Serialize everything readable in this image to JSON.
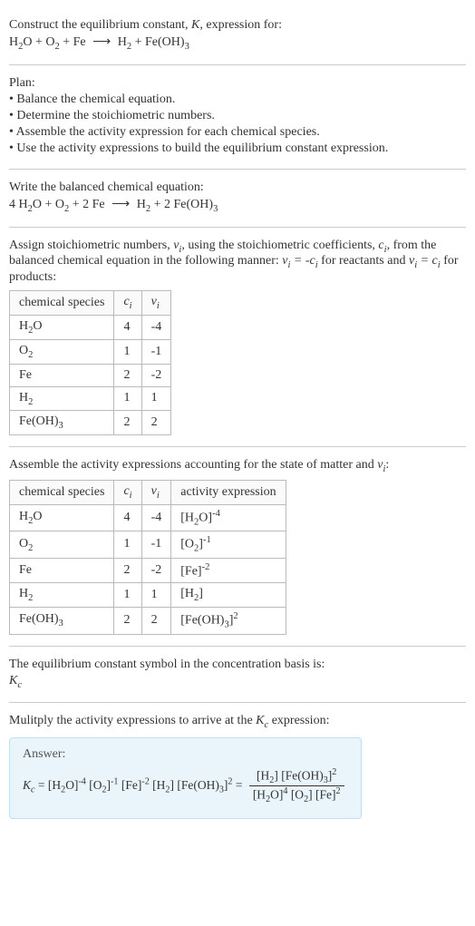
{
  "header": {
    "construct_line": "Construct the equilibrium constant, K, expression for:"
  },
  "plan": {
    "title": "Plan:",
    "items": [
      "Balance the chemical equation.",
      "Determine the stoichiometric numbers.",
      "Assemble the activity expression for each chemical species.",
      "Use the activity expressions to build the equilibrium constant expression."
    ]
  },
  "balanced": {
    "title": "Write the balanced chemical equation:"
  },
  "assign": {
    "intro1": "Assign stoichiometric numbers, ",
    "intro2": ", using the stoichiometric coefficients, ",
    "intro3": ", from the balanced chemical equation in the following manner: ",
    "intro4": " for reactants and ",
    "intro5": " for products:"
  },
  "table1": {
    "headers": {
      "species": "chemical species"
    },
    "rows": [
      {
        "species_html": "H<sub>2</sub>O",
        "c": "4",
        "v": "-4"
      },
      {
        "species_html": "O<sub>2</sub>",
        "c": "1",
        "v": "-1"
      },
      {
        "species_html": "Fe",
        "c": "2",
        "v": "-2"
      },
      {
        "species_html": "H<sub>2</sub>",
        "c": "1",
        "v": "1"
      },
      {
        "species_html": "Fe(OH)<sub>3</sub>",
        "c": "2",
        "v": "2"
      }
    ]
  },
  "assemble": {
    "intro_a": "Assemble the activity expressions accounting for the state of matter and ",
    "intro_b": ":"
  },
  "table2": {
    "headers": {
      "species": "chemical species",
      "activity": "activity expression"
    },
    "rows": [
      {
        "species_html": "H<sub>2</sub>O",
        "c": "4",
        "v": "-4",
        "act_html": "[H<sub>2</sub>O]<sup>-4</sup>"
      },
      {
        "species_html": "O<sub>2</sub>",
        "c": "1",
        "v": "-1",
        "act_html": "[O<sub>2</sub>]<sup>-1</sup>"
      },
      {
        "species_html": "Fe",
        "c": "2",
        "v": "-2",
        "act_html": "[Fe]<sup>-2</sup>"
      },
      {
        "species_html": "H<sub>2</sub>",
        "c": "1",
        "v": "1",
        "act_html": "[H<sub>2</sub>]"
      },
      {
        "species_html": "Fe(OH)<sub>3</sub>",
        "c": "2",
        "v": "2",
        "act_html": "[Fe(OH)<sub>3</sub>]<sup>2</sup>"
      }
    ]
  },
  "kc_symbol": {
    "line": "The equilibrium constant symbol in the concentration basis is:"
  },
  "multiply": {
    "line_a": "Mulitply the activity expressions to arrive at the ",
    "line_b": " expression:"
  },
  "answer": {
    "label": "Answer:"
  }
}
